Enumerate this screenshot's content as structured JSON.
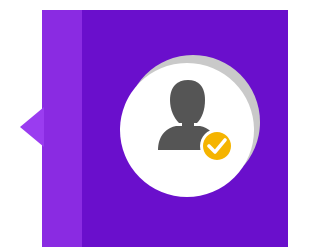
{
  "colors": {
    "panel_main": "#6a0fcc",
    "panel_strip": "#8a2be2",
    "pointer": "#9a3cf0",
    "circle_fill": "#ffffff",
    "circle_shadow": "#c9c9c9",
    "user_icon": "#555555",
    "check_badge": "#f5b400",
    "check_mark": "#ffffff"
  },
  "icons": {
    "main": "verified-user-icon",
    "badge": "checkmark-icon"
  }
}
